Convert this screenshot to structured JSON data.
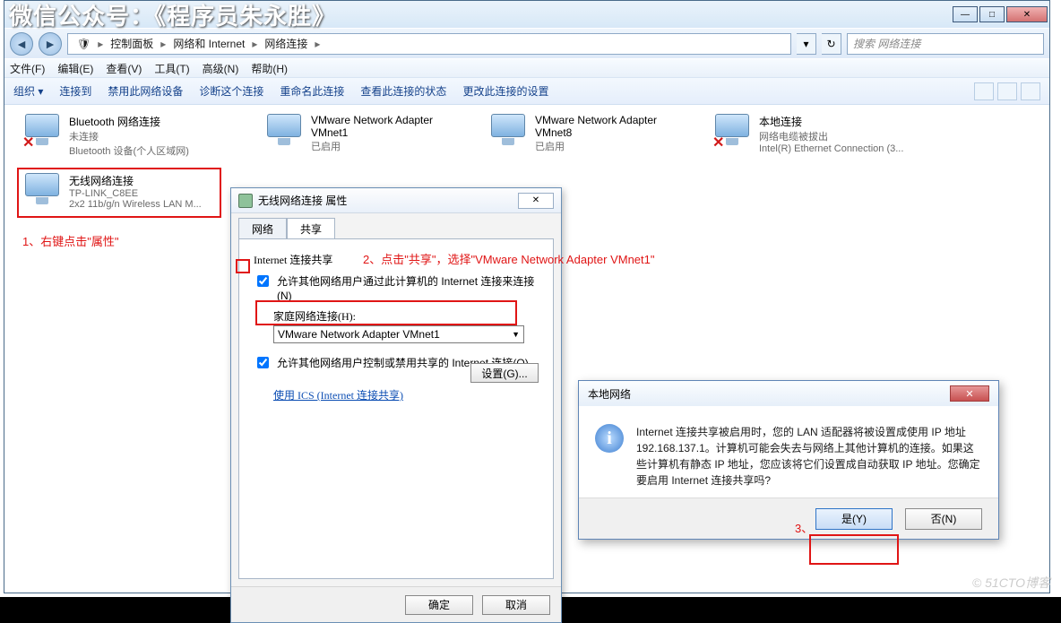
{
  "watermark_top": "微信公众号：《程序员朱永胜》",
  "watermark_bottom": "© 51CTO博客",
  "window": {
    "min": "—",
    "max": "□",
    "close": "✕",
    "nav_back": "◄",
    "nav_fwd": "►",
    "breadcrumb": [
      "控制面板",
      "网络和 Internet",
      "网络连接"
    ],
    "refresh": "↻",
    "search_placeholder": "搜索 网络连接",
    "menus": [
      "文件(F)",
      "编辑(E)",
      "查看(V)",
      "工具(T)",
      "高级(N)",
      "帮助(H)"
    ],
    "toolbar": [
      "组织 ▾",
      "连接到",
      "禁用此网络设备",
      "诊断这个连接",
      "重命名此连接",
      "查看此连接的状态",
      "更改此连接的设置"
    ]
  },
  "connections": {
    "bt": {
      "h": "Bluetooth 网络连接",
      "s1": "未连接",
      "s2": "Bluetooth 设备(个人区域网)"
    },
    "vm1": {
      "h": "VMware Network Adapter",
      "h2": "VMnet1",
      "s": "已启用"
    },
    "vm8": {
      "h": "VMware Network Adapter",
      "h2": "VMnet8",
      "s": "已启用"
    },
    "lan": {
      "h": "本地连接",
      "s1": "网络电缆被拔出",
      "s2": "Intel(R) Ethernet Connection (3..."
    },
    "wifi": {
      "h": "无线网络连接",
      "s1": "TP-LINK_C8EE",
      "s2": "2x2 11b/g/n Wireless LAN M..."
    }
  },
  "anno1": "1、右键点击\"属性\"",
  "anno2": "2、点击\"共享\"，选择\"VMware Network Adapter VMnet1\"",
  "anno3": "3、",
  "prop": {
    "title": "无线网络连接 属性",
    "tab1": "网络",
    "tab2": "共享",
    "group": "Internet 连接共享",
    "cb1": "允许其他网络用户通过此计算机的 Internet 连接来连接(N)",
    "sublabel": "家庭网络连接(H):",
    "combo": "VMware Network Adapter VMnet1",
    "cb2": "允许其他网络用户控制或禁用共享的 Internet 连接(O)",
    "link": "使用 ICS (Internet 连接共享)",
    "settings": "设置(G)...",
    "ok": "确定",
    "cancel": "取消"
  },
  "msg": {
    "title": "本地网络",
    "text": "Internet 连接共享被启用时，您的 LAN 适配器将被设置成使用 IP 地址 192.168.137.1。计算机可能会失去与网络上其他计算机的连接。如果这些计算机有静态 IP 地址，您应该将它们设置成自动获取 IP 地址。您确定要启用 Internet 连接共享吗?",
    "yes": "是(Y)",
    "no": "否(N)"
  }
}
